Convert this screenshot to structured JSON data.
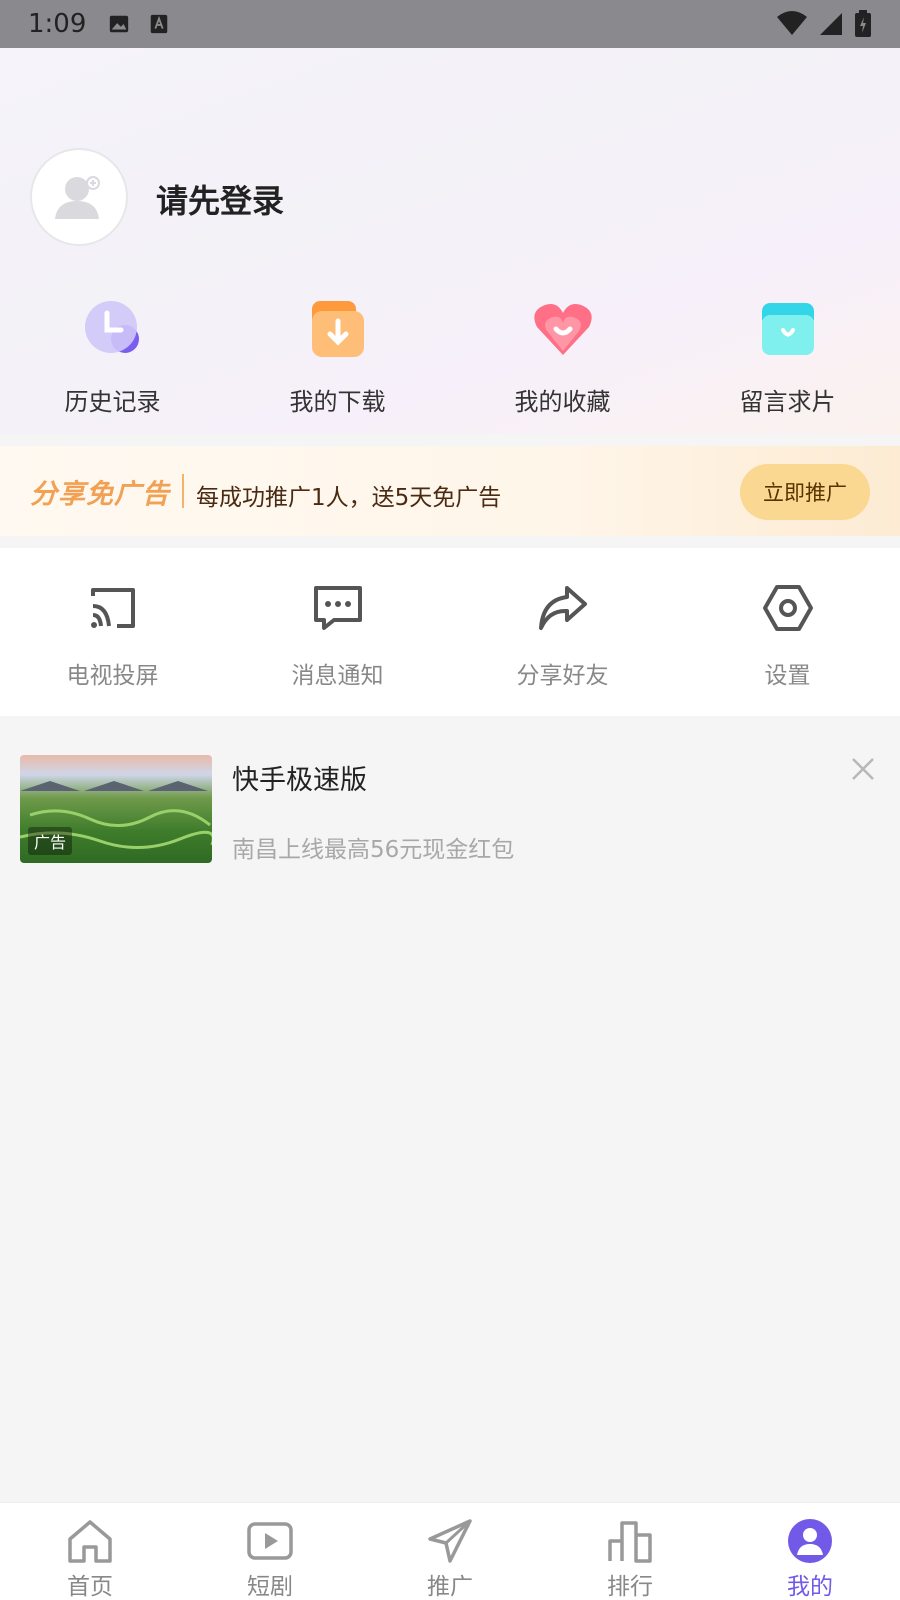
{
  "status_bar": {
    "time": "1:09"
  },
  "profile": {
    "login_prompt": "请先登录"
  },
  "quick_actions": [
    {
      "label": "历史记录",
      "icon": "history-icon"
    },
    {
      "label": "我的下载",
      "icon": "download-icon"
    },
    {
      "label": "我的收藏",
      "icon": "favorites-heart-icon"
    },
    {
      "label": "留言求片",
      "icon": "request-mail-icon"
    }
  ],
  "share_banner": {
    "title": "分享免广告",
    "description": "每成功推广1人，送5天免广告",
    "button_label": "立即推广"
  },
  "tools": [
    {
      "label": "电视投屏",
      "icon": "cast-icon"
    },
    {
      "label": "消息通知",
      "icon": "message-icon"
    },
    {
      "label": "分享好友",
      "icon": "share-icon"
    },
    {
      "label": "设置",
      "icon": "settings-icon"
    }
  ],
  "ad": {
    "title": "快手极速版",
    "description": "南昌上线最高56元现金红包",
    "tag": "广告"
  },
  "bottom_nav": [
    {
      "label": "首页",
      "icon": "home-icon",
      "active": false
    },
    {
      "label": "短剧",
      "icon": "play-icon",
      "active": false
    },
    {
      "label": "推广",
      "icon": "send-icon",
      "active": false
    },
    {
      "label": "排行",
      "icon": "ranking-icon",
      "active": false
    },
    {
      "label": "我的",
      "icon": "profile-icon",
      "active": true
    }
  ],
  "colors": {
    "accent": "#7259e8",
    "share_orange": "#f2a154",
    "share_button": "#fbd891"
  }
}
